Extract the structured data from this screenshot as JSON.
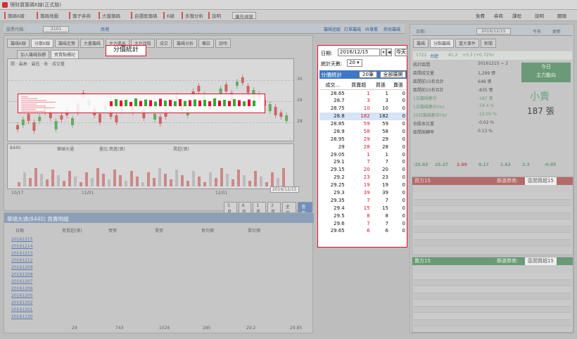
{
  "app": {
    "title": "理財寶籌碼K線(正式版)"
  },
  "menu": {
    "items": [
      "籌碼K線",
      "籌碼地圖",
      "籌子券商",
      "大盤籌碼",
      "自選股籌碼",
      "K線",
      "多籌分析",
      "說明",
      "擴充視窗"
    ],
    "right": [
      "免費",
      "券商",
      "課程",
      "說明",
      "關閉"
    ]
  },
  "toolbar": {
    "stock_label": "股票代碼:",
    "stock_value": "2101",
    "stock_name": "南港",
    "links": [
      "籌碼追蹤",
      "訂單籌碼",
      "IR專業",
      "券商籌碼"
    ],
    "right_date_label": "日期:",
    "right_date": "2016/12/15",
    "right_btns": [
      "今天",
      "更新"
    ]
  },
  "chart": {
    "tabs": [
      "籌碼K線",
      "分散K線",
      "籌碼走勢",
      "大量籌碼",
      "主力進出",
      "大戶持股",
      "成交",
      "籌碼分析",
      "備註",
      "說明"
    ],
    "toggle_labels": [
      "加入籌碼指標",
      "買賣點標記"
    ],
    "legend": [
      "開",
      "最高",
      "最低",
      "收",
      "成交量"
    ],
    "y_labels": [
      "30",
      "29",
      "28"
    ],
    "volume_label": "8440",
    "volume_legend": [
      "華碩大通",
      "量比:買進(張)",
      "賣超(張)"
    ],
    "x_labels": [
      "10/17",
      "11/01",
      "12/01",
      "2016/12/15"
    ],
    "range_buttons": [
      "3月",
      "6月",
      "1年",
      "2年",
      "全部",
      "查詢"
    ]
  },
  "tooltip": {
    "label": "分價統計"
  },
  "popup": {
    "date_label": "日期:",
    "date_value": "2016/12/15",
    "spin_prev": "◀",
    "spin_down": "▾",
    "spin_next": "▶",
    "today_label": "今天",
    "days_label": "統計天數:",
    "days_value": "20",
    "days_arrow": "▾",
    "panel_title": "分價統計",
    "btn_count": "20筆",
    "btn_all": "全部展開",
    "columns": [
      "成交...",
      "買賣超",
      "買張",
      "賣張"
    ],
    "rows": [
      [
        "28.65",
        "1",
        "1",
        "0"
      ],
      [
        "28.7",
        "3",
        "3",
        "0"
      ],
      [
        "28.75",
        "10",
        "10",
        "0"
      ],
      [
        "28.8",
        "182",
        "182",
        "0"
      ],
      [
        "28.85",
        "59",
        "59",
        "0"
      ],
      [
        "28.9",
        "58",
        "58",
        "0"
      ],
      [
        "28.95",
        "29",
        "29",
        "0"
      ],
      [
        "29",
        "28",
        "28",
        "0"
      ],
      [
        "29.05",
        "1",
        "1",
        "0"
      ],
      [
        "29.1",
        "7",
        "7",
        "0"
      ],
      [
        "29.15",
        "20",
        "20",
        "0"
      ],
      [
        "29.2",
        "23",
        "23",
        "0"
      ],
      [
        "29.25",
        "19",
        "19",
        "0"
      ],
      [
        "29.3",
        "39",
        "39",
        "0"
      ],
      [
        "29.35",
        "7",
        "7",
        "0"
      ],
      [
        "29.4",
        "15",
        "15",
        "0"
      ],
      [
        "29.5",
        "8",
        "8",
        "0"
      ],
      [
        "29.6",
        "7",
        "7",
        "0"
      ],
      [
        "29.65",
        "6",
        "6",
        "0"
      ]
    ],
    "red_values": [
      "1",
      "3",
      "10",
      "182",
      "59",
      "58",
      "29",
      "28",
      "1",
      "7",
      "20",
      "23",
      "19",
      "39",
      "7",
      "15",
      "8",
      "7",
      "6"
    ]
  },
  "lower": {
    "title": "華碩大通(8440) 買賣明細",
    "columns": [
      "日期",
      "買賣超(張)",
      "買張",
      "賣張",
      "買均價",
      "賣均價"
    ],
    "dates": [
      "20161215",
      "20161214",
      "20161213",
      "20161212",
      "20161209",
      "20161208",
      "20161207",
      "20161206",
      "20161205",
      "20161202",
      "20161201",
      "20161130"
    ],
    "totals": [
      "29",
      "743",
      "1026",
      "285",
      "29.2",
      "29.85"
    ]
  },
  "right_panel": {
    "tabs": [
      "籌碼",
      "分點籌碼",
      "重大事件",
      "新聞"
    ],
    "quote": {
      "code": "1722",
      "name": "台肥",
      "price": "41.2",
      "change": "+0.3 (+0.72%)"
    },
    "stats_labels": [
      "統計區間",
      "區間成交量",
      "區間前15名合計",
      "區間前15名合計",
      "1日籌碼集中",
      "1日籌碼集中(%)",
      "20日籌碼集中(%)",
      "佔股本比重",
      "區間周轉率"
    ],
    "stats_values": [
      "20161215 ~ 2",
      "1,299 張",
      "648 張",
      "-835 張",
      "-187 張",
      "-14.4 %",
      "-12.05 %",
      "-0.02 %",
      "0.13 %"
    ],
    "today_box": [
      "今日",
      "主力動向"
    ],
    "verdict": "小賣",
    "verdict_qty": "187 張",
    "metrics": [
      "-25.63",
      "25.27",
      "2.69",
      "0.17",
      "1.63",
      "3.3",
      "-0.05"
    ],
    "buy_title": "買方15",
    "sell_title": "賣方15",
    "filter_label": "篩選券商:",
    "filter_value": "區間買超15"
  }
}
